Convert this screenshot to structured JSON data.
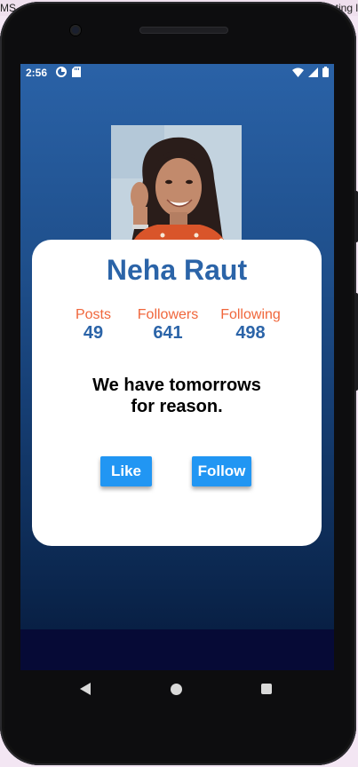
{
  "background_window": {
    "left_text": "MS",
    "right_text": "ting l"
  },
  "status_bar": {
    "time": "2:56",
    "left_icons": [
      "data-saver-icon",
      "sd-card-icon"
    ],
    "right_icons": [
      "wifi-icon",
      "cell-signal-icon",
      "battery-icon"
    ]
  },
  "profile": {
    "name": "Neha Raut",
    "avatar_icon": "profile-photo",
    "stats": [
      {
        "label": "Posts",
        "value": "49"
      },
      {
        "label": "Followers",
        "value": "641"
      },
      {
        "label": "Following",
        "value": "498"
      }
    ],
    "quote_line1": "We have tomorrows",
    "quote_line2": "for reason."
  },
  "buttons": {
    "like_label": "Like",
    "follow_label": "Follow"
  },
  "nav_bar": {
    "icons": [
      "back-icon",
      "home-icon",
      "recents-icon"
    ]
  },
  "colors": {
    "name_blue": "#2b64a8",
    "stat_label_orange": "#f0663b",
    "button_blue": "#2196f3",
    "gradient_top": "#2a62a7",
    "gradient_bottom": "#061a3c"
  }
}
